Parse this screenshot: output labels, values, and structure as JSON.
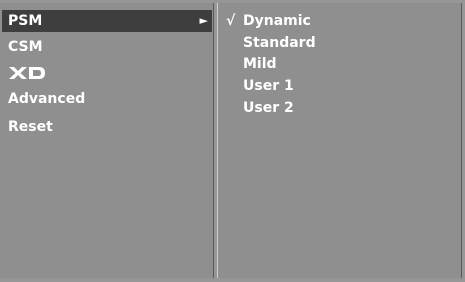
{
  "main_menu": {
    "items": [
      {
        "label": "PSM",
        "selected": true,
        "arrow": "►"
      },
      {
        "label": "CSM"
      },
      {
        "label": "XD",
        "logo": true
      },
      {
        "label": "Advanced"
      },
      {
        "label": "Reset"
      }
    ]
  },
  "psm_submenu": {
    "check_mark": "√",
    "items": [
      {
        "label": "Dynamic",
        "checked": true
      },
      {
        "label": "Standard"
      },
      {
        "label": "Mild"
      },
      {
        "label": "User 1"
      },
      {
        "label": "User 2"
      }
    ]
  }
}
